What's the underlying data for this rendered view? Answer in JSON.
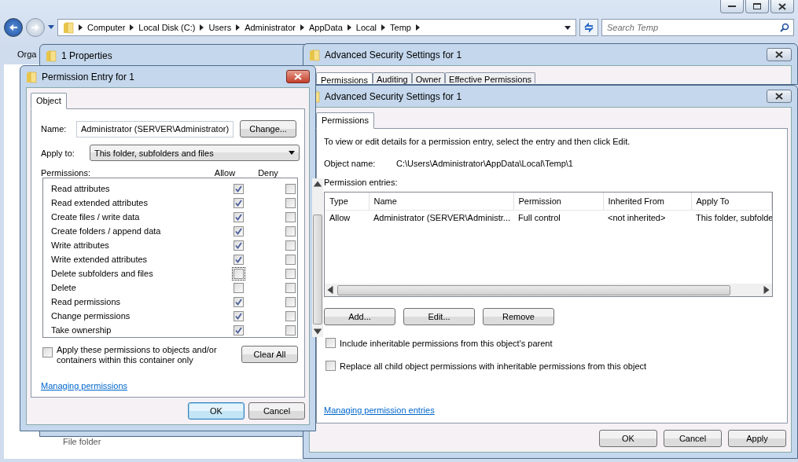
{
  "explorer": {
    "breadcrumb": [
      "Computer",
      "Local Disk (C:)",
      "Users",
      "Administrator",
      "AppData",
      "Local",
      "Temp"
    ],
    "search": {
      "placeholder": "Search Temp"
    },
    "toolbar_label": "Orga",
    "file_type": "File folder"
  },
  "properties_window": {
    "title": "1 Properties"
  },
  "security_back": {
    "title": "Advanced Security Settings for 1",
    "tabs": [
      {
        "label": "Permissions",
        "selected": true
      },
      {
        "label": "Auditing",
        "selected": false
      },
      {
        "label": "Owner",
        "selected": false
      },
      {
        "label": "Effective Permissions",
        "selected": false
      }
    ]
  },
  "security_front": {
    "title": "Advanced Security Settings for 1",
    "tabs": [
      {
        "label": "Permissions",
        "selected": true
      }
    ],
    "instructions": "To view or edit details for a permission entry, select the entry and then click Edit.",
    "object_name_label": "Object name:",
    "object_name": "C:\\Users\\Administrator\\AppData\\Local\\Temp\\1",
    "entries_label": "Permission entries:",
    "table": {
      "columns": [
        "Type",
        "Name",
        "Permission",
        "Inherited From",
        "Apply To"
      ],
      "rows": [
        {
          "cells": [
            "Allow",
            "Administrator (SERVER\\Administr...",
            "Full control",
            "<not inherited>",
            "This folder, subfolde"
          ],
          "selected": false
        }
      ]
    },
    "buttons": [
      "Add...",
      "Edit...",
      "Remove"
    ],
    "options": [
      {
        "label": "Include inheritable permissions from this object's parent",
        "checked": false
      },
      {
        "label": "Replace all child object permissions with inheritable permissions from this object",
        "checked": false
      }
    ],
    "link": "Managing permission entries",
    "footer_buttons": [
      "OK",
      "Cancel",
      "Apply"
    ]
  },
  "permission_entry": {
    "title": "Permission Entry for 1",
    "tabs": [
      {
        "label": "Object",
        "selected": true
      }
    ],
    "name_label": "Name:",
    "name_value": "Administrator (SERVER\\Administrator)",
    "change_button": "Change...",
    "apply_label": "Apply to:",
    "apply_value": "This folder, subfolders and files",
    "permissions_label": "Permissions:",
    "allow_header": "Allow",
    "deny_header": "Deny",
    "permissions": [
      {
        "label": "Read attributes",
        "allow": true,
        "deny": false,
        "focused": false
      },
      {
        "label": "Read extended attributes",
        "allow": true,
        "deny": false,
        "focused": false
      },
      {
        "label": "Create files / write data",
        "allow": true,
        "deny": false,
        "focused": false
      },
      {
        "label": "Create folders / append data",
        "allow": true,
        "deny": false,
        "focused": false
      },
      {
        "label": "Write attributes",
        "allow": true,
        "deny": false,
        "focused": false
      },
      {
        "label": "Write extended attributes",
        "allow": true,
        "deny": false,
        "focused": false
      },
      {
        "label": "Delete subfolders and files",
        "allow": false,
        "deny": false,
        "focused": true
      },
      {
        "label": "Delete",
        "allow": false,
        "deny": false,
        "focused": false
      },
      {
        "label": "Read permissions",
        "allow": true,
        "deny": false,
        "focused": false
      },
      {
        "label": "Change permissions",
        "allow": true,
        "deny": false,
        "focused": false
      },
      {
        "label": "Take ownership",
        "allow": true,
        "deny": false,
        "focused": false
      }
    ],
    "apply_only": {
      "label": "Apply these permissions to objects and/or containers within this container only",
      "checked": false
    },
    "clear_button": "Clear All",
    "link": "Managing permissions",
    "buttons": [
      "OK",
      "Cancel"
    ]
  }
}
